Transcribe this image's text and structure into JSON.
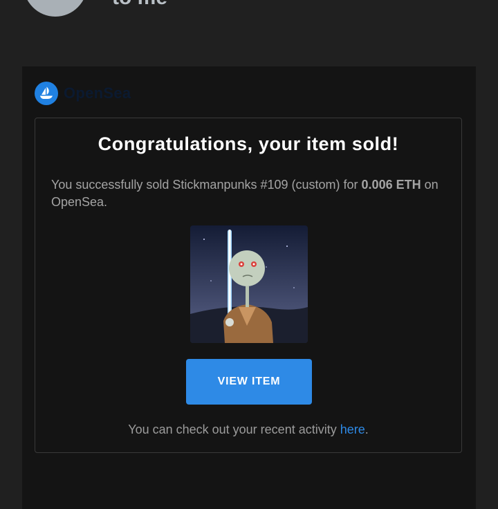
{
  "header": {
    "recipient_text": "to me"
  },
  "brand": {
    "name": "OpenSea",
    "accent": "#2081e2",
    "icon": "opensea-boat-icon"
  },
  "email": {
    "title": "Congratulations, your item sold!",
    "body_prefix": "You successfully sold Stickmanpunks #109 (custom) for ",
    "price": "0.006 ETH",
    "body_suffix": " on OpenSea.",
    "button_label": "VIEW ITEM",
    "footer_prefix": "You can check out your recent activity ",
    "footer_link": "here",
    "footer_suffix": "."
  }
}
